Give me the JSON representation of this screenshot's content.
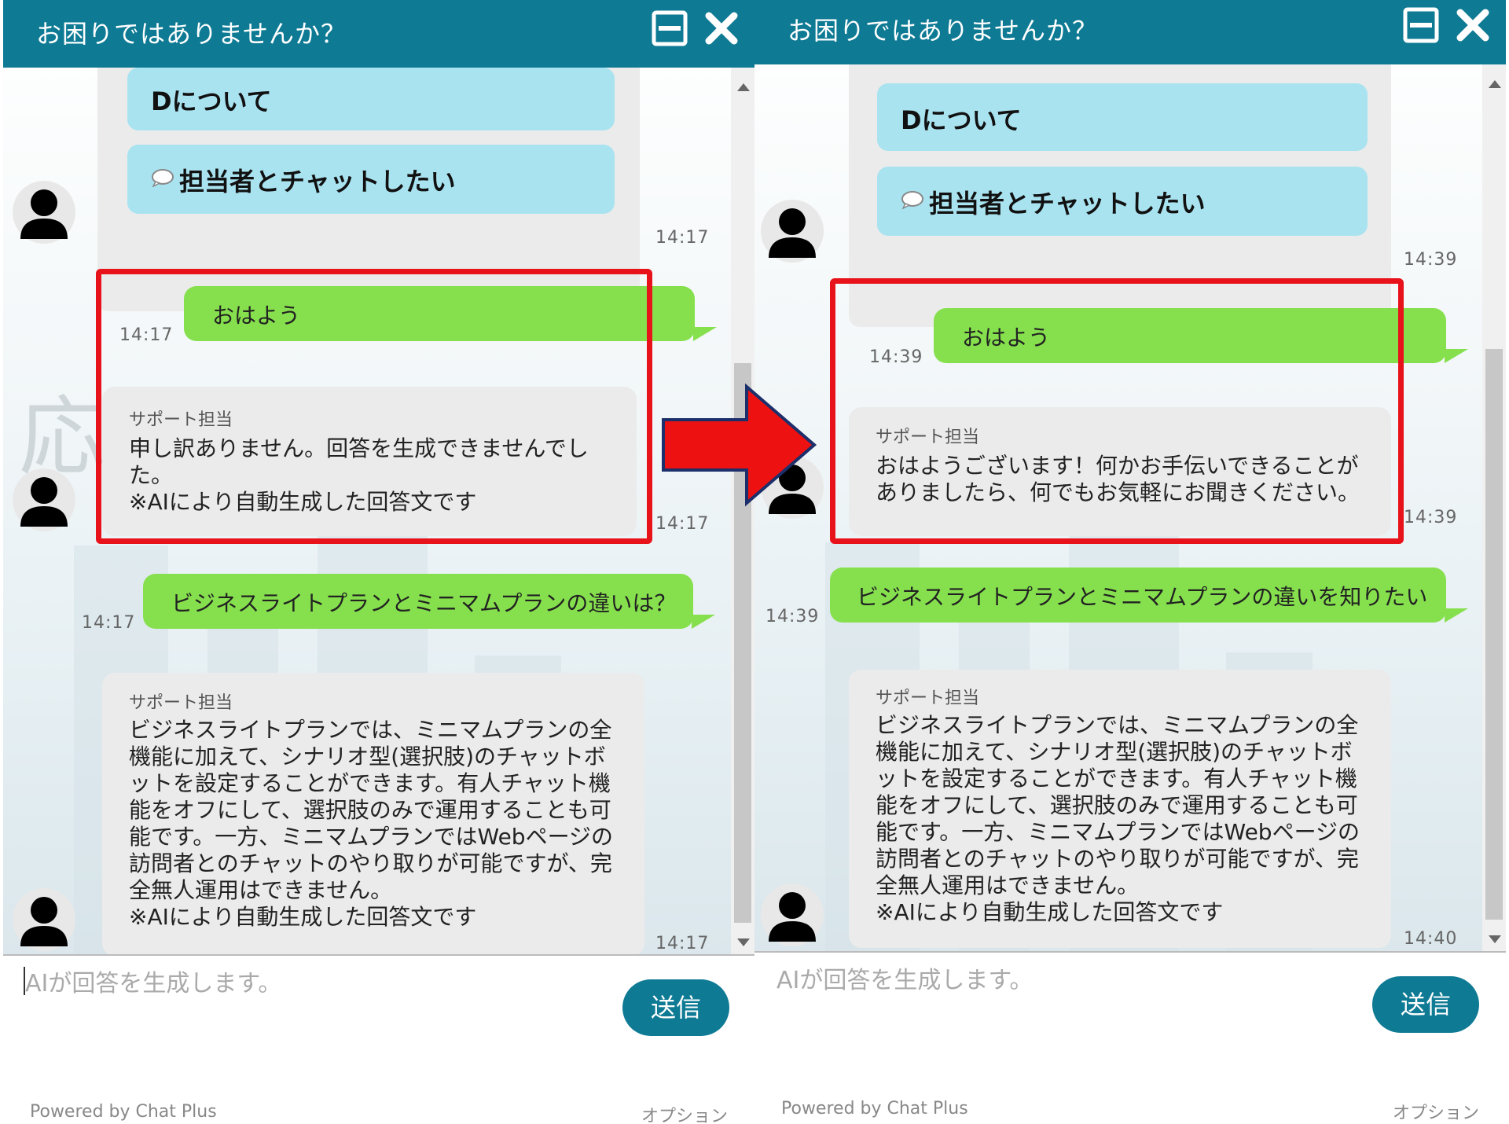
{
  "left": {
    "header_title": "お困りではありませんか？",
    "option_d": "Dについて",
    "option_chat": "担当者とチャットしたい",
    "time_1": "14:17",
    "user_msg_1": "おはよう",
    "time_user_1": "14:17",
    "bot_name_1": "サポート担当",
    "bot_text_1": "申し訳ありません。回答を生成できませんでした。\n※AIにより自動生成した回答文です",
    "time_bot_1": "14:17",
    "user_msg_2": "ビジネスライトプランとミニマムプランの違いは？",
    "time_user_2": "14:17",
    "bot_name_2": "サポート担当",
    "bot_text_2": "ビジネスライトプランでは、ミニマムプランの全機能に加えて、シナリオ型(選択肢)のチャットボットを設定することができます。有人チャット機能をオフにして、選択肢のみで運用することも可能です。一方、ミニマムプランではWebページの訪問者とのチャットのやり取りが可能ですが、完全無人運用はできません。\n※AIにより自動生成した回答文です",
    "time_bot_2": "14:17",
    "input_placeholder": "AIが回答を生成します。",
    "send_label": "送信",
    "powered_by": "Powered by Chat Plus",
    "options_label": "オプション"
  },
  "right": {
    "header_title": "お困りではありませんか？",
    "option_d": "Dについて",
    "option_chat": "担当者とチャットしたい",
    "time_1": "14:39",
    "user_msg_1": "おはよう",
    "time_user_1": "14:39",
    "bot_name_1": "サポート担当",
    "bot_text_1": "おはようございます！何かお手伝いできることがありましたら、何でもお気軽にお聞きください。",
    "time_bot_1": "14:39",
    "user_msg_2": "ビジネスライトプランとミニマムプランの違いを知りたい",
    "time_user_2": "14:39",
    "bot_name_2": "サポート担当",
    "bot_text_2": "ビジネスライトプランでは、ミニマムプランの全機能に加えて、シナリオ型(選択肢)のチャットボットを設定することができます。有人チャット機能をオフにして、選択肢のみで運用することも可能です。一方、ミニマムプランではWebページの訪問者とのチャットのやり取りが可能ですが、完全無人運用はできません。\n※AIにより自動生成した回答文です",
    "time_bot_2": "14:40",
    "input_placeholder": "AIが回答を生成します。",
    "send_label": "送信",
    "powered_by": "Powered by Chat Plus",
    "options_label": "オプション"
  },
  "icons": {
    "minimize": "minimize-icon",
    "close": "close-icon",
    "avatar": "user-avatar-icon",
    "speech": "speech-bubble-icon",
    "arrow": "right-arrow-icon"
  },
  "colors": {
    "header": "#0e7a94",
    "option": "#a9e3f0",
    "user_bubble": "#86e04e",
    "bot_bubble": "#ebebeb",
    "highlight": "#e8121b"
  }
}
